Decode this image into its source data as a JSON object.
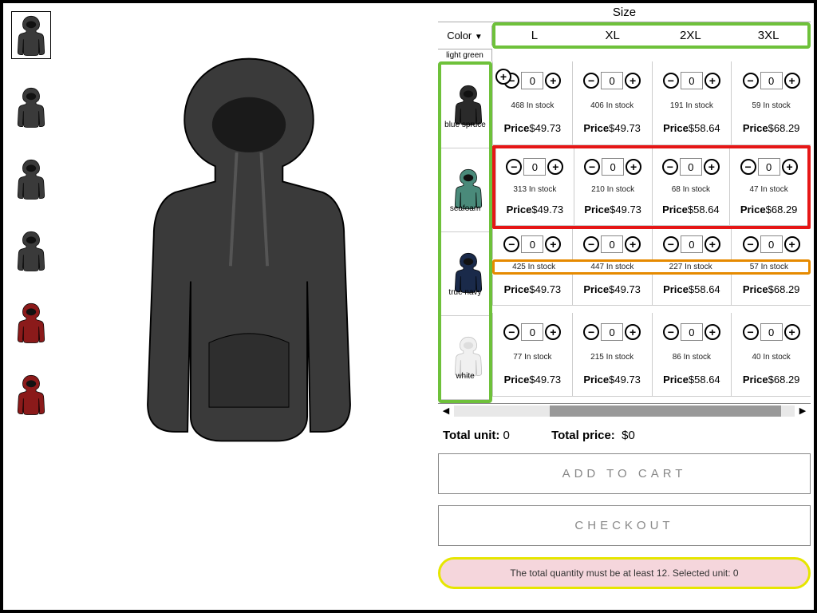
{
  "thumbnails": [
    {
      "color": "#3a3a3a",
      "selected": true
    },
    {
      "color": "#3a3a3a",
      "selected": false
    },
    {
      "color": "#3a3a3a",
      "selected": false
    },
    {
      "color": "#3a3a3a",
      "selected": false
    },
    {
      "color": "#8b1a1a",
      "selected": false
    },
    {
      "color": "#8b1a1a",
      "selected": false
    }
  ],
  "headers": {
    "size_title": "Size",
    "color_title": "Color",
    "light_green": "light green"
  },
  "sizes": [
    "L",
    "XL",
    "2XL",
    "3XL"
  ],
  "colors": [
    {
      "name": "blue spruce",
      "fill": "#2a2a2a"
    },
    {
      "name": "seafoam",
      "fill": "#4a8a7a"
    },
    {
      "name": "true navy",
      "fill": "#1a2a4a"
    },
    {
      "name": "white",
      "fill": "#f0f0f0"
    }
  ],
  "cells": {
    "blue_spruce": [
      {
        "qty": "0",
        "stock": "468 In stock",
        "price_lbl": "Price",
        "price_val": "$49.73"
      },
      {
        "qty": "0",
        "stock": "406 In stock",
        "price_lbl": "Price",
        "price_val": "$49.73"
      },
      {
        "qty": "0",
        "stock": "191 In stock",
        "price_lbl": "Price",
        "price_val": "$58.64"
      },
      {
        "qty": "0",
        "stock": "59 In stock",
        "price_lbl": "Price",
        "price_val": "$68.29"
      }
    ],
    "seafoam": [
      {
        "qty": "0",
        "stock": "313 In stock",
        "price_lbl": "Price",
        "price_val": "$49.73"
      },
      {
        "qty": "0",
        "stock": "210 In stock",
        "price_lbl": "Price",
        "price_val": "$49.73"
      },
      {
        "qty": "0",
        "stock": "68 In stock",
        "price_lbl": "Price",
        "price_val": "$58.64"
      },
      {
        "qty": "0",
        "stock": "47 In stock",
        "price_lbl": "Price",
        "price_val": "$68.29"
      }
    ],
    "true_navy": [
      {
        "qty": "0",
        "stock": "425 In stock",
        "price_lbl": "Price",
        "price_val": "$49.73"
      },
      {
        "qty": "0",
        "stock": "447 In stock",
        "price_lbl": "Price",
        "price_val": "$49.73"
      },
      {
        "qty": "0",
        "stock": "227 In stock",
        "price_lbl": "Price",
        "price_val": "$58.64"
      },
      {
        "qty": "0",
        "stock": "57 In stock",
        "price_lbl": "Price",
        "price_val": "$68.29"
      }
    ],
    "white": [
      {
        "qty": "0",
        "stock": "77 In stock",
        "price_lbl": "Price",
        "price_val": "$49.73"
      },
      {
        "qty": "0",
        "stock": "215 In stock",
        "price_lbl": "Price",
        "price_val": "$49.73"
      },
      {
        "qty": "0",
        "stock": "86 In stock",
        "price_lbl": "Price",
        "price_val": "$58.64"
      },
      {
        "qty": "0",
        "stock": "40 In stock",
        "price_lbl": "Price",
        "price_val": "$68.29"
      }
    ]
  },
  "totals": {
    "unit_label": "Total unit:",
    "unit_value": "0",
    "price_label": "Total price:",
    "price_value": "$0"
  },
  "buttons": {
    "add": "ADD TO CART",
    "checkout": "CHECKOUT"
  },
  "warning": "The total quantity must be at least 12. Selected unit: 0",
  "glyphs": {
    "minus": "−",
    "plus": "+",
    "tri": "▼",
    "left": "◀",
    "right": "▶"
  }
}
